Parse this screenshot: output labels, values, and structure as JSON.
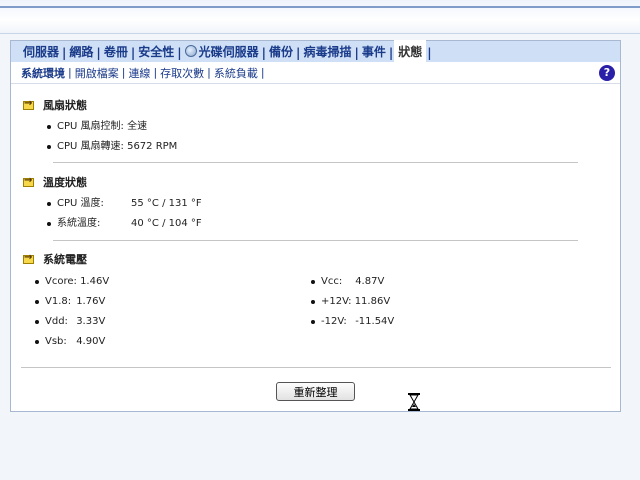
{
  "tabs": [
    {
      "label": "伺服器",
      "active": false
    },
    {
      "label": "網路",
      "active": false
    },
    {
      "label": "卷冊",
      "active": false
    },
    {
      "label": "安全性",
      "active": false
    },
    {
      "label": "光碟伺服器",
      "active": false,
      "icon": "disc-icon"
    },
    {
      "label": "備份",
      "active": false
    },
    {
      "label": "病毒掃描",
      "active": false
    },
    {
      "label": "事件",
      "active": false
    },
    {
      "label": "狀態",
      "active": true
    }
  ],
  "subtabs": [
    {
      "label": "系統環境",
      "active": true
    },
    {
      "label": "開啟檔案",
      "active": false
    },
    {
      "label": "連線",
      "active": false
    },
    {
      "label": "存取次數",
      "active": false
    },
    {
      "label": "系統負載",
      "active": false
    }
  ],
  "help": {
    "glyph": "?"
  },
  "fan": {
    "title": "風扇狀態",
    "items": [
      {
        "label": "CPU 風扇控制:",
        "value": "全速"
      },
      {
        "label": "CPU 風扇轉速:",
        "value": "5672 RPM"
      }
    ]
  },
  "temperature": {
    "title": "溫度狀態",
    "items": [
      {
        "label": "CPU 溫度:",
        "value": "55 °C / 131 °F"
      },
      {
        "label": "系統溫度:",
        "value": "40 °C / 104 °F"
      }
    ]
  },
  "voltage": {
    "title": "系統電壓",
    "left": [
      {
        "label": "Vcore:",
        "value": "1.46V"
      },
      {
        "label": "V1.8:",
        "value": "1.76V"
      },
      {
        "label": "Vdd:",
        "value": "3.33V"
      },
      {
        "label": "Vsb:",
        "value": "4.90V"
      }
    ],
    "right": [
      {
        "label": "Vcc:",
        "value": "4.87V"
      },
      {
        "label": "+12V:",
        "value": "11.86V"
      },
      {
        "label": "-12V:",
        "value": "-11.54V"
      }
    ]
  },
  "refresh_label": "重新整理",
  "colors": {
    "tab_text": "#1a3a8a",
    "tab_bar": "#cfe0f6",
    "help_icon": "#2a1fa8",
    "arrow_icon": "#f7d84a"
  }
}
